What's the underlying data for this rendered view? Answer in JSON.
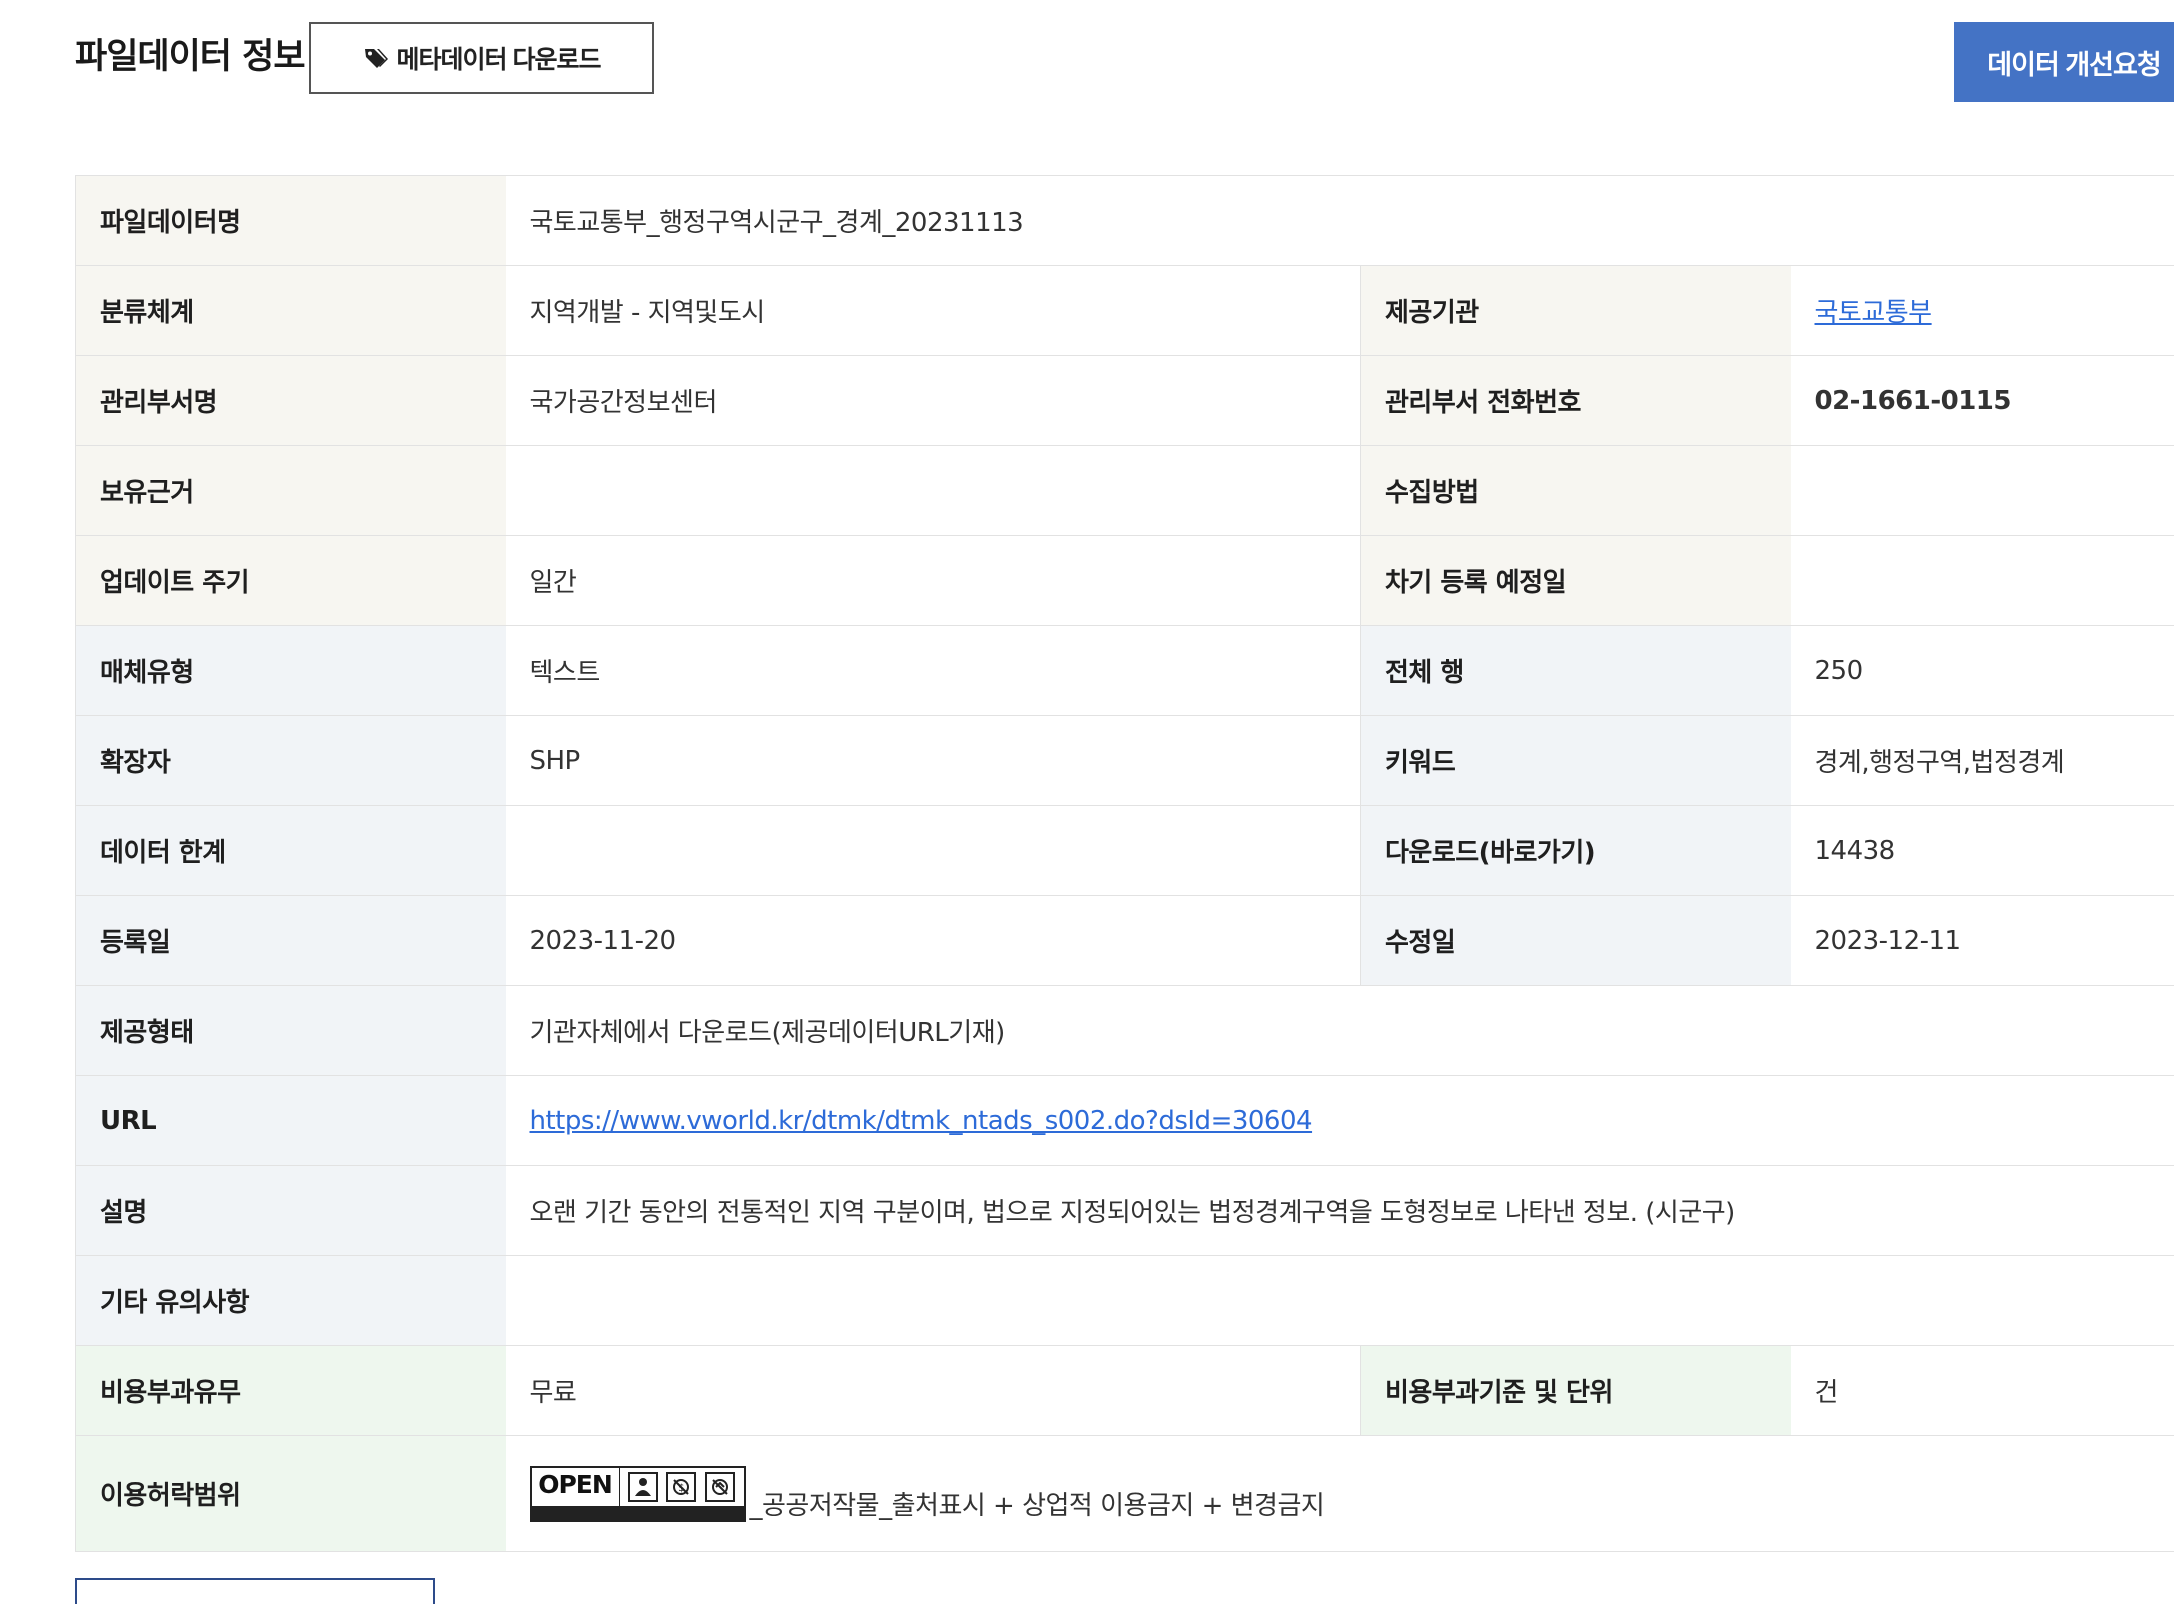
{
  "header": {
    "title": "파일데이터 정보",
    "meta_button": "메타데이터 다운로드",
    "improve_button": "데이터 개선요청"
  },
  "rows": {
    "file_name": {
      "label": "파일데이터명",
      "value": "국토교통부_행정구역시군구_경계_20231113"
    },
    "category": {
      "label": "분류체계",
      "value": "지역개발 - 지역및도시"
    },
    "provider": {
      "label": "제공기관",
      "value": "국토교통부"
    },
    "dept": {
      "label": "관리부서명",
      "value": "국가공간정보센터"
    },
    "dept_phone": {
      "label": "관리부서 전화번호",
      "value": "02-1661-0115"
    },
    "basis": {
      "label": "보유근거",
      "value": ""
    },
    "collect": {
      "label": "수집방법",
      "value": ""
    },
    "update_cycle": {
      "label": "업데이트 주기",
      "value": "일간"
    },
    "next_reg": {
      "label": "차기 등록 예정일",
      "value": ""
    },
    "media_type": {
      "label": "매체유형",
      "value": "텍스트"
    },
    "total_rows": {
      "label": "전체 행",
      "value": "250"
    },
    "extension": {
      "label": "확장자",
      "value": "SHP"
    },
    "keywords": {
      "label": "키워드",
      "value": "경계,행정구역,법정경계"
    },
    "data_limit": {
      "label": "데이터 한계",
      "value": ""
    },
    "downloads": {
      "label": "다운로드(바로가기)",
      "value": "14438"
    },
    "reg_date": {
      "label": "등록일",
      "value": "2023-11-20"
    },
    "mod_date": {
      "label": "수정일",
      "value": "2023-12-11"
    },
    "provide_form": {
      "label": "제공형태",
      "value": "기관자체에서 다운로드(제공데이터URL기재)"
    },
    "url": {
      "label": "URL",
      "value": "https://www.vworld.kr/dtmk/dtmk_ntads_s002.do?dsId=30604"
    },
    "description": {
      "label": "설명",
      "value": "오랜 기간 동안의 전통적인 지역 구분이며, 법으로 지정되어있는 법정경계구역을 도형정보로 나타낸 정보. (시군구)"
    },
    "notes": {
      "label": "기타 유의사항",
      "value": ""
    },
    "cost": {
      "label": "비용부과유무",
      "value": "무료"
    },
    "cost_basis": {
      "label": "비용부과기준 및 단위",
      "value": "건"
    },
    "license": {
      "label": "이용허락범위",
      "badge_text": "OPEN",
      "value": "_공공저작물_출처표시 + 상업적 이용금지 + 변경금지"
    }
  },
  "colors": {
    "accent": "#4473c5",
    "link": "#2d6bd8",
    "th_beige": "#f7f6f1",
    "th_gray": "#f1f4f7",
    "th_green": "#eef7ee"
  },
  "icons": {
    "meta_button": "tag-icon",
    "license": [
      "person-icon",
      "no-money-icon",
      "no-change-icon"
    ]
  }
}
